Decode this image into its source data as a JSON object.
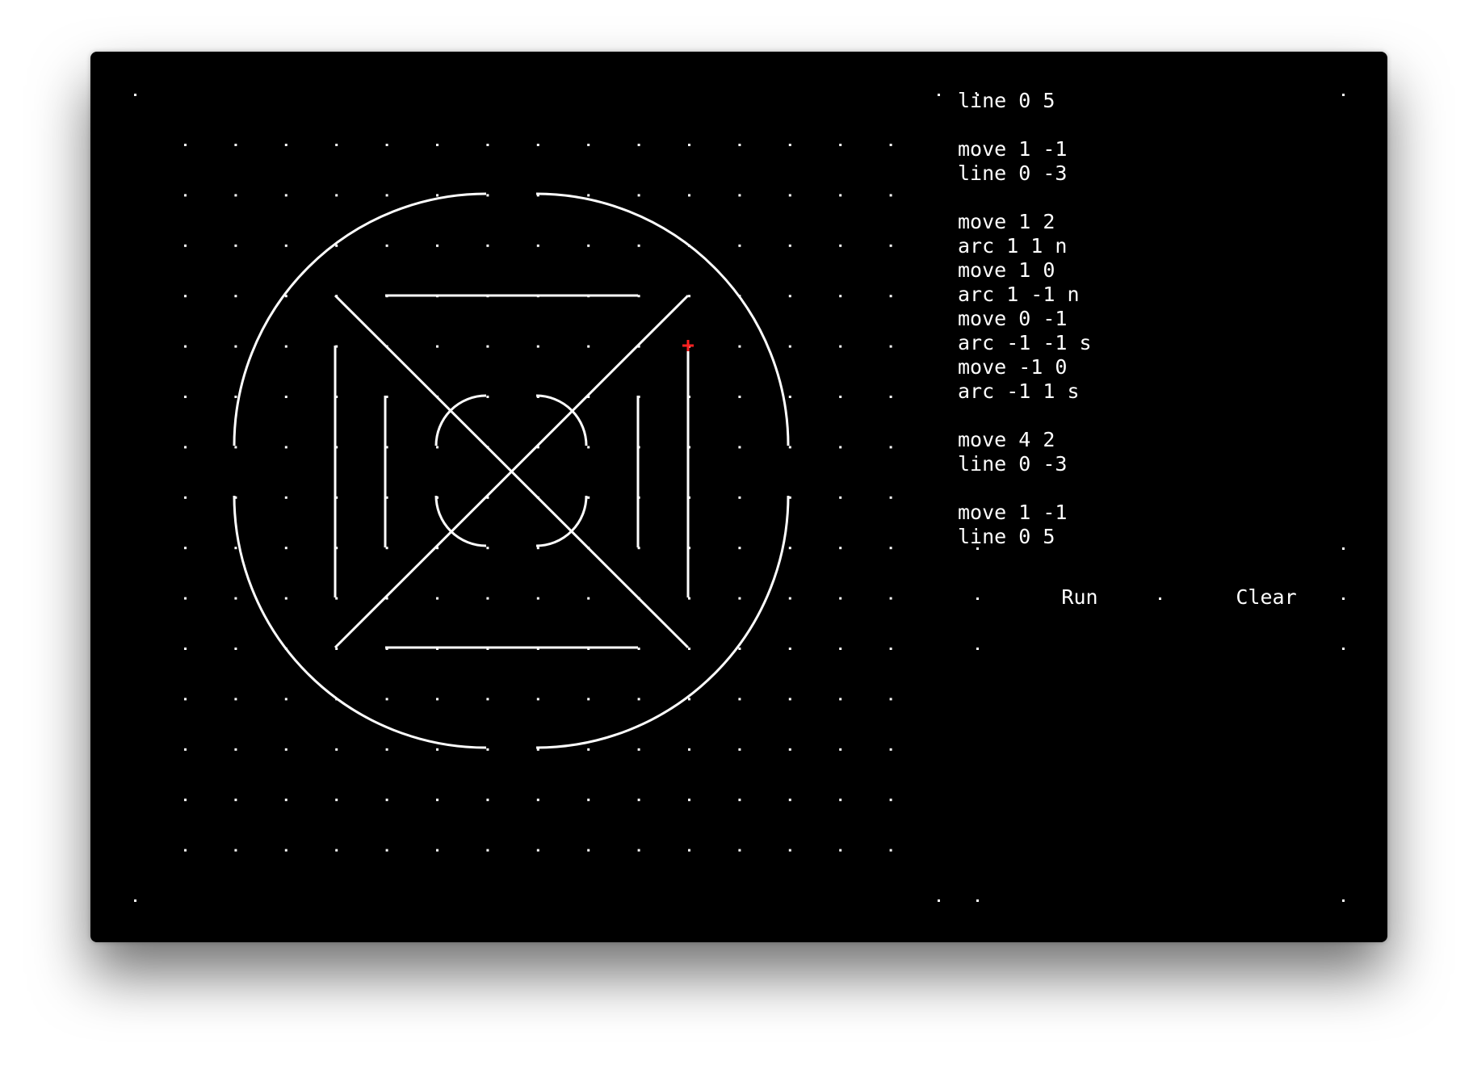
{
  "code_editor": {
    "text": "line 0 5\n\nmove 1 -1\nline 0 -3\n\nmove 1 2\narc 1 1 n\nmove 1 0\narc 1 -1 n\nmove 0 -1\narc -1 -1 s\nmove -1 0\narc -1 1 s\n\nmove 4 2\nline 0 -3\n\nmove 1 -1\nline 0 5"
  },
  "buttons": {
    "run_label": "Run",
    "clear_label": "Clear"
  },
  "colors": {
    "background": "#000000",
    "stroke": "#ffffff",
    "cursor": "#ff2020"
  },
  "icons": {
    "cursor": "red-plus-cursor-icon"
  }
}
